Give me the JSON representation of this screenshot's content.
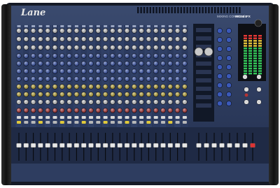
{
  "brand": {
    "logo_text": "Lane"
  },
  "product": {
    "tagline": "MIXING CONSOLE",
    "model": "MG24/4FX"
  },
  "colors": {
    "chassis": "#1c2436",
    "panel": "#2a3a5c",
    "end_cheek": "#151515",
    "knob_white": "#d8d8d8",
    "knob_blue": "#3b59b8",
    "knob_yellow": "#c9b23a",
    "knob_red": "#b43232",
    "meter_green": "#34c759",
    "meter_red": "#e53935"
  },
  "console": {
    "channel_strip_count": 24,
    "master_fader_count": 8
  }
}
